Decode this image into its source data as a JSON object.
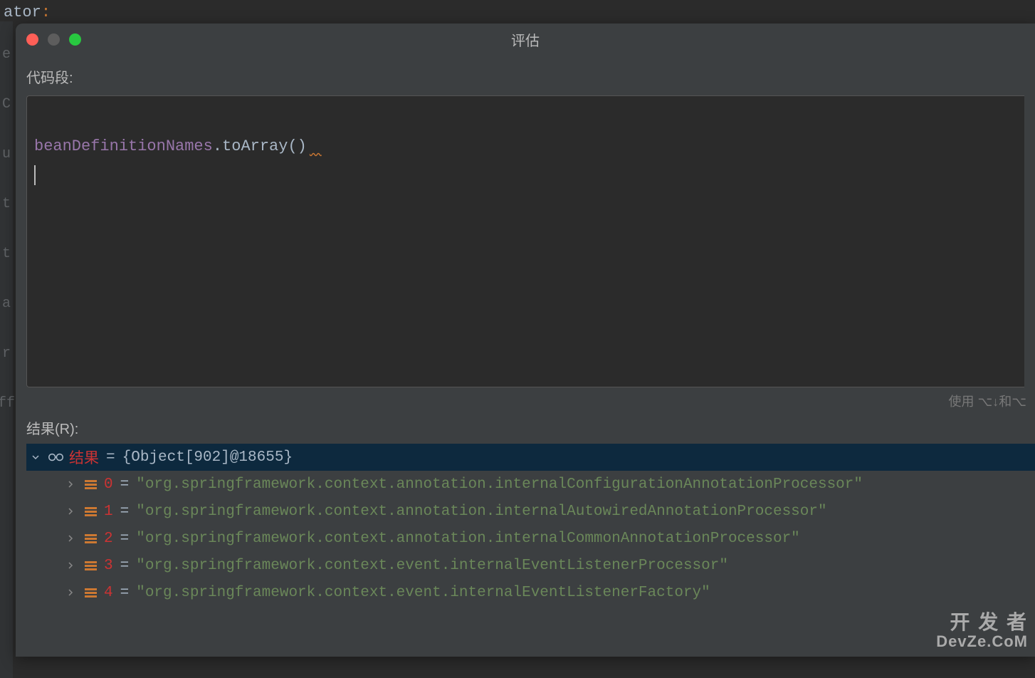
{
  "background": {
    "text_fragment": "ator",
    "gutter_chars": [
      "e",
      "C",
      "u",
      "t",
      "t",
      "a",
      "r",
      "ff"
    ]
  },
  "dialog": {
    "title": "评估",
    "code_label": "代码段:",
    "code": {
      "variable": "beanDefinitionNames",
      "method_call": ".toArray()"
    },
    "hint": "使用 ⌥↓和⌥",
    "results_label": "结果(R):",
    "result_root": {
      "name": "结果",
      "value": "{Object[902]@18655}"
    },
    "result_items": [
      {
        "index": "0",
        "value": "\"org.springframework.context.annotation.internalConfigurationAnnotationProcessor\""
      },
      {
        "index": "1",
        "value": "\"org.springframework.context.annotation.internalAutowiredAnnotationProcessor\""
      },
      {
        "index": "2",
        "value": "\"org.springframework.context.annotation.internalCommonAnnotationProcessor\""
      },
      {
        "index": "3",
        "value": "\"org.springframework.context.event.internalEventListenerProcessor\""
      },
      {
        "index": "4",
        "value": "\"org.springframework.context.event.internalEventListenerFactory\""
      }
    ]
  },
  "watermark": {
    "line1": "开 发 者",
    "line2": "DevZe.CoM"
  }
}
